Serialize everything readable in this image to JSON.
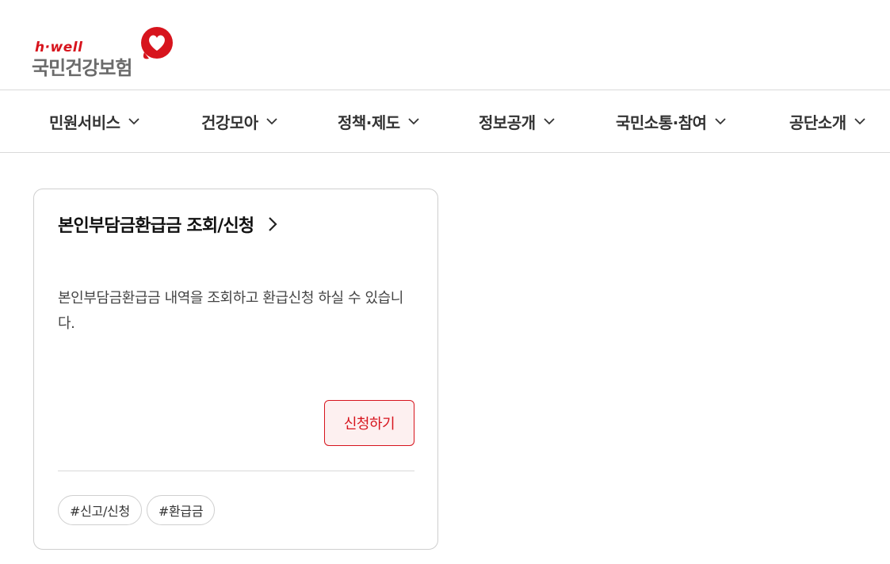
{
  "brand": {
    "sub": "h·well",
    "name": "국민건강보험",
    "accent_color": "#d7141d"
  },
  "nav": {
    "items": [
      {
        "label": "민원서비스",
        "icon": "chevron-down-icon"
      },
      {
        "label": "건강모아",
        "icon": "chevron-down-icon"
      },
      {
        "label": "정책·제도",
        "icon": "chevron-down-icon"
      },
      {
        "label": "정보공개",
        "icon": "chevron-down-icon"
      },
      {
        "label": "국민소통·참여",
        "icon": "chevron-down-icon"
      },
      {
        "label": "공단소개",
        "icon": "chevron-down-icon"
      }
    ]
  },
  "card": {
    "title": "본인부담금환급금 조회/신청",
    "title_icon": "chevron-right-icon",
    "description": "본인부담금환급금 내역을 조회하고 환급신청 하실 수 있습니다.",
    "apply_label": "신청하기",
    "tags": [
      "#신고/신청",
      "#환급금"
    ]
  }
}
